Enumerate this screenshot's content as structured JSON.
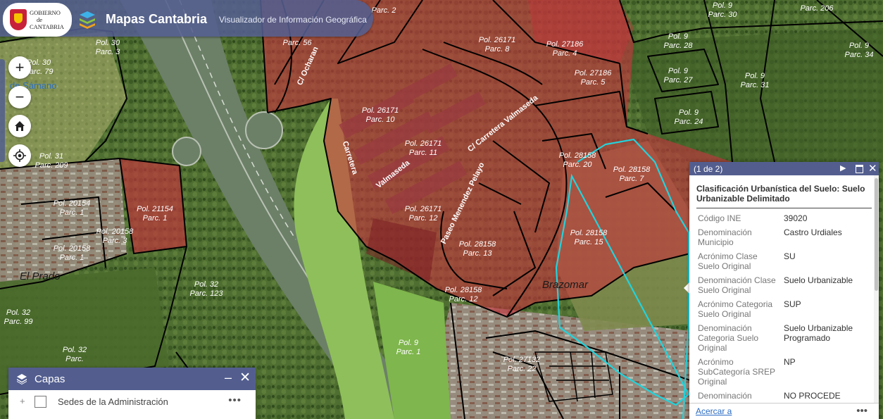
{
  "header": {
    "logo_lines": [
      "GOBIERNO",
      "de",
      "CANTABRIA"
    ],
    "title": "Mapas Cantabria",
    "subtitle": "Visualizador de Información Geográfica"
  },
  "colors": {
    "header_bg": "#545f8f",
    "urban_red": "#c7333d",
    "urbanizable_outline": "#22d3dc",
    "link_blue": "#2b6cc4"
  },
  "map_controls": {
    "zoom_in": "+",
    "zoom_out": "−",
    "home_icon": "home-icon",
    "locate_icon": "locate-icon"
  },
  "map": {
    "parcels": [
      {
        "pol": "Pol. 30",
        "parc": "Parc. 3"
      },
      {
        "pol": "Pol. 30",
        "parc": "Parc. 79"
      },
      {
        "pol": "Pol. 31",
        "parc": "Parc. 209"
      },
      {
        "pol": "Pol. 20154",
        "parc": "Parc. 1"
      },
      {
        "pol": "Pol. 20158",
        "parc": "Parc. 1"
      },
      {
        "pol": "Pol. 20158",
        "parc": "Parc. 3"
      },
      {
        "pol": "Pol. 21154",
        "parc": "Parc. 1"
      },
      {
        "pol": "Pol. 32",
        "parc": "Parc. 123"
      },
      {
        "pol": "Pol. 32",
        "parc": "Parc. 99"
      },
      {
        "pol": "Pol. 32",
        "parc": "Parc."
      },
      {
        "pol": "Pol. 9",
        "parc": "Parc. 1"
      },
      {
        "pol": "Pol. 26171",
        "parc": "Parc. 10"
      },
      {
        "pol": "Pol. 26171",
        "parc": "Parc. 11"
      },
      {
        "pol": "Pol. 26171",
        "parc": "Parc. 12"
      },
      {
        "pol": "Pol. 26171",
        "parc": "Parc. 8"
      },
      {
        "pol": "Pol. 27186",
        "parc": "Parc. 4"
      },
      {
        "pol": "Pol. 27186",
        "parc": "Parc. 5"
      },
      {
        "pol": "Pol. 28158",
        "parc": "Parc. 20"
      },
      {
        "pol": "Pol. 28158",
        "parc": "Parc. 7"
      },
      {
        "pol": "Pol. 28158",
        "parc": "Parc. 15"
      },
      {
        "pol": "Pol. 28158",
        "parc": "Parc. 13"
      },
      {
        "pol": "Pol. 28158",
        "parc": "Parc. 12"
      },
      {
        "pol": "Pol. 27132",
        "parc": "Parc. 22"
      },
      {
        "pol": "Pol. 9",
        "parc": "Parc. 28"
      },
      {
        "pol": "Pol. 9",
        "parc": "Parc. 27"
      },
      {
        "pol": "Pol. 9",
        "parc": "Parc. 24"
      },
      {
        "pol": "Pol. 9",
        "parc": "Parc. 31"
      },
      {
        "pol": "Pol. 9",
        "parc": "Parc. 30"
      },
      {
        "pol": "Pol. 9",
        "parc": "Parc. 34"
      },
      {
        "pol": "",
        "parc": "Parc. 206"
      },
      {
        "pol": "",
        "parc": "Parc. 56"
      },
      {
        "pol": "",
        "parc": "Parc. 2"
      }
    ],
    "streets": [
      "C/ Carretera Valmaseda",
      "Carretera",
      "Valmaseda",
      "Paseo Menendez Pelayo",
      "C/ Ocharan"
    ],
    "places": [
      "El Prado",
      "Brazomar"
    ],
    "water_label": "de Sámano"
  },
  "layers_panel": {
    "title": "Capas",
    "minimize": "–",
    "close": "✕",
    "items": [
      {
        "expand": "+",
        "name": "Sedes de la Administración",
        "more": "•••"
      }
    ]
  },
  "popup": {
    "count": "(1 de 2)",
    "title": "Clasificación Urbanística del Suelo: Suelo Urbanizable Delimitado",
    "attributes": [
      {
        "key": "Código INE",
        "value": "39020"
      },
      {
        "key": "Denominación Municipio",
        "value": "Castro Urdiales"
      },
      {
        "key": "Acrónimo Clase Suelo Original",
        "value": "SU"
      },
      {
        "key": "Denominación Clase Suelo Original",
        "value": "Suelo Urbanizable"
      },
      {
        "key": "Acrónimo Categoria Suelo Original",
        "value": "SUP"
      },
      {
        "key": "Denominación Categoria Suelo Original",
        "value": "Suelo Urbanizable Programado"
      },
      {
        "key": "Acrónimo SubCategoría SREP Original",
        "value": "NP"
      },
      {
        "key": "Denominación",
        "value": "NO PROCEDE"
      }
    ],
    "zoom_link": "Acercar a",
    "more": "•••"
  }
}
